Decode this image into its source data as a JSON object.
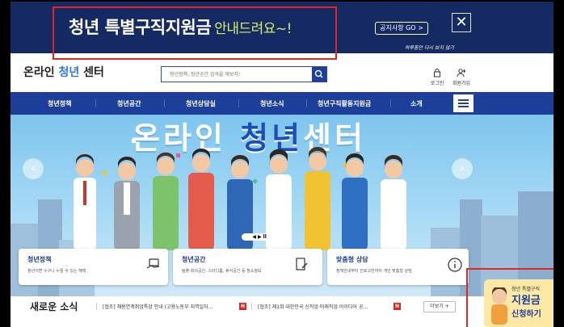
{
  "banner": {
    "title_main": "청년 특별구직지원금",
    "title_sub": "안내드려요~!",
    "notice_button": "공지사항 GO >",
    "close_icon": "close-icon",
    "no_more_text": "하루동안 다시 보지 않기"
  },
  "header": {
    "logo_prefix": "온라인 ",
    "logo_accent": "청년",
    "logo_suffix": " 센터",
    "search_placeholder": "청년정책, 청년공간 검색을 해보자!",
    "login_label": "로그인",
    "signup_label": "회원가입"
  },
  "nav": {
    "items": [
      "청년정책",
      "청년공간",
      "청년상담실",
      "청년소식",
      "청년구직활동지원금",
      "소개"
    ]
  },
  "hero": {
    "title_prefix": "온라인 ",
    "title_accent": "청년",
    "title_suffix": "센터",
    "play_ctrl": "◀ ▶ ll"
  },
  "cards": [
    {
      "title": "청년정책",
      "desc": "청년이면 누구나 누릴 수 있는 혜택"
    },
    {
      "title": "청년공간",
      "desc": "팀플·회의공간, 스터디룸, 휴식공간 등 청소정보"
    },
    {
      "title": "맞춤형 상담",
      "desc": "정책안내부터 진로고민까지 개인 맞춤형 상담"
    }
  ],
  "news": {
    "title": "새로운 소식",
    "items": [
      "[협조] 채용연계취업특강 안내 (고용노동부 지역일자...",
      "[협조] 제1회 대한민국 신직업·미래직업 아이디어 공..."
    ],
    "badge": "N",
    "more_button": "더보기 +"
  },
  "float_banner": {
    "sub": "청년 특별구직",
    "main": "지원금",
    "cta": "신청하기"
  },
  "colors": {
    "banner_bg": "#152a63",
    "nav_bg": "#1d3e99",
    "highlight": "#d8ef6a",
    "alert_red": "#e0261f"
  }
}
